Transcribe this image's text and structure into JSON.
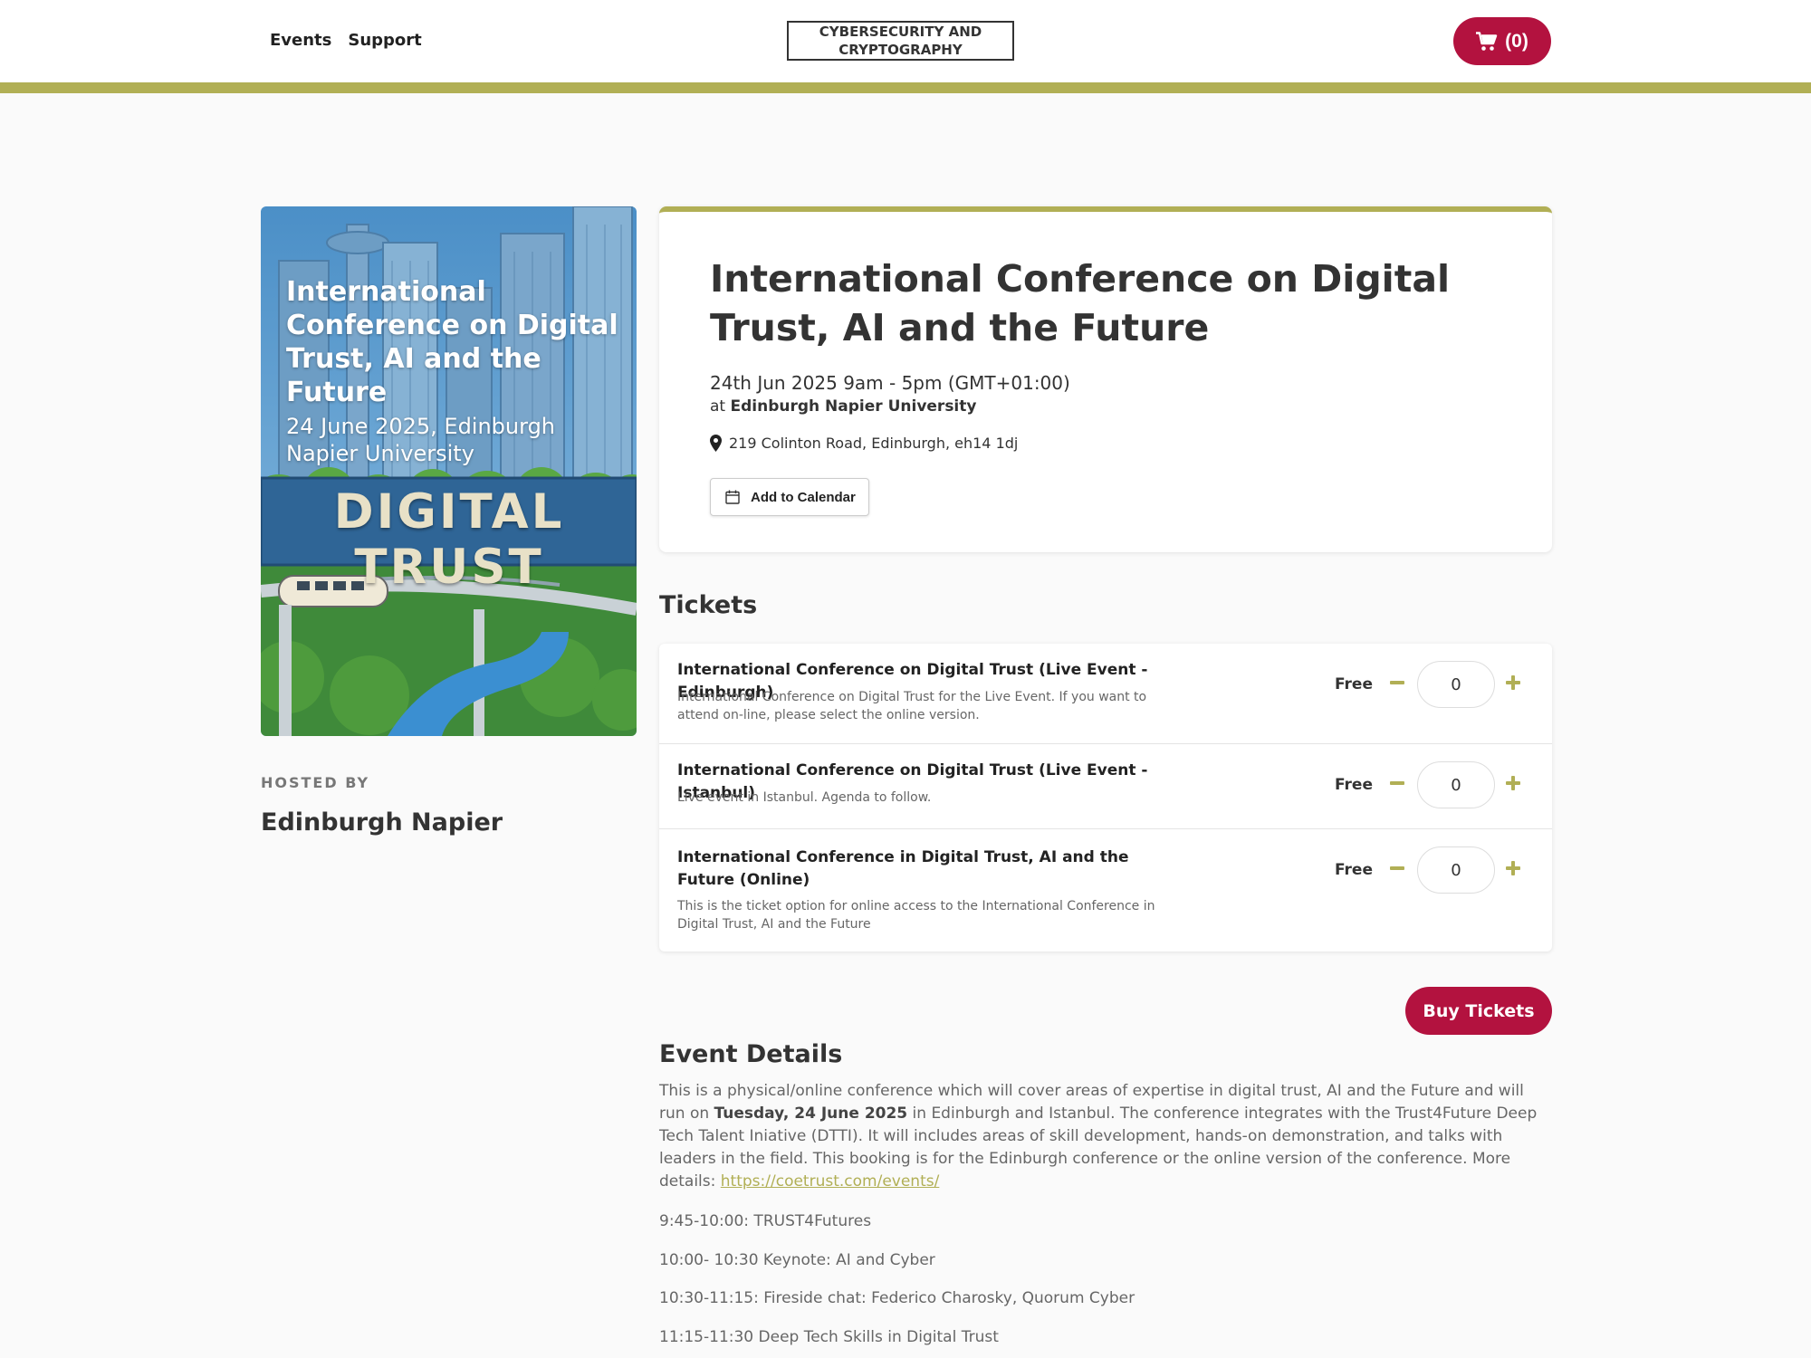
{
  "header": {
    "nav": [
      "Events",
      "Support"
    ],
    "logo_text": "CYBERSECURITY AND CRYPTOGRAPHY",
    "cart_label": "(0)"
  },
  "colors": {
    "accent": "#b1af55",
    "brand": "#b3123f"
  },
  "poster": {
    "title": "International Conference on Digital Trust, AI and the Future",
    "subtitle": "24 June 2025, Edinburgh Napier University",
    "sign": "DIGITAL TRUST"
  },
  "host": {
    "label": "HOSTED BY",
    "name": "Edinburgh Napier"
  },
  "event": {
    "title": "International Conference on Digital Trust, AI and the Future",
    "date": "24th Jun 2025 9am - 5pm (GMT+01:00)",
    "at_prefix": "at",
    "venue": "Edinburgh Napier University",
    "address": "219 Colinton Road, Edinburgh, eh14 1dj",
    "calendar_label": "Add to Calendar"
  },
  "tickets": {
    "heading": "Tickets",
    "items": [
      {
        "name": "International Conference on Digital Trust (Live Event - Edinburgh)",
        "description": "International Conference on Digital Trust for the Live Event. If you want to attend on-line, please select the online version.",
        "price": "Free",
        "quantity": "0"
      },
      {
        "name": "International Conference on Digital Trust (Live Event - Istanbul)",
        "description": "Live event in Istanbul. Agenda to follow.",
        "price": "Free",
        "quantity": "0"
      },
      {
        "name": "International Conference in Digital Trust, AI and the Future (Online)",
        "description": "This is the ticket option for online access to the International Conference in Digital Trust, AI and the Future",
        "price": "Free",
        "quantity": "0"
      }
    ],
    "buy_label": "Buy Tickets"
  },
  "details": {
    "heading": "Event Details",
    "intro_1": "This is a physical/online conference which will cover areas of expertise in digital trust, AI and the Future and will run on ",
    "intro_bold": "Tuesday, 24 June 2025",
    "intro_2": " in Edinburgh and Istanbul. The conference integrates with the Trust4Future Deep Tech Talent Iniative (DTTI). It will includes areas of skill development, hands-on demonstration, and talks with leaders in the field. This booking is for the Edinburgh conference or the online version of the conference. More details: ",
    "link": "https://coetrust.com/events/",
    "agenda": [
      "9:45-10:00: TRUST4Futures",
      "10:00- 10:30 Keynote: AI and Cyber",
      "10:30-11:15: Fireside chat: Federico Charosky, Quorum Cyber",
      "11:15-11:30 Deep Tech Skills in Digital Trust"
    ]
  }
}
